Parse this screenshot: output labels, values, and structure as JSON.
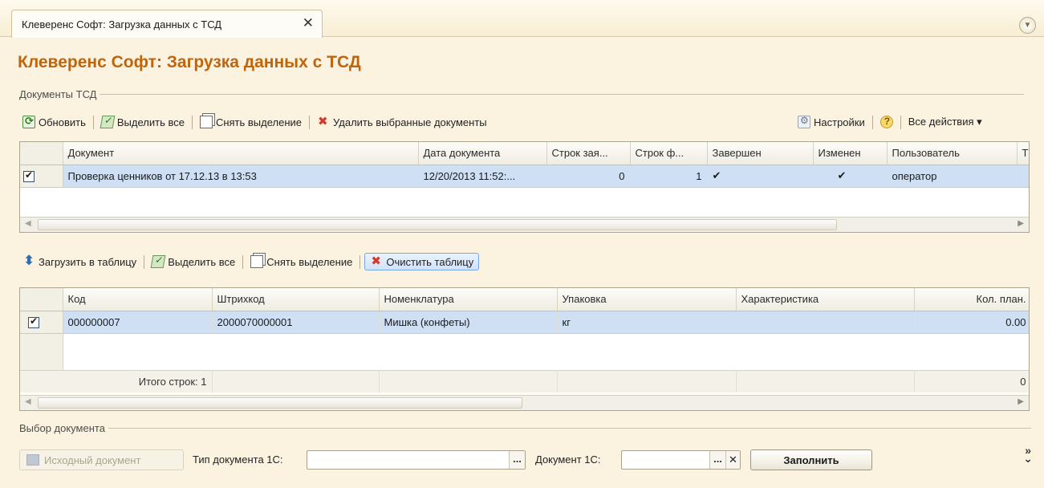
{
  "tab": {
    "title": "Клеверенс Софт: Загрузка данных с ТСД",
    "close_glyph": "✕"
  },
  "page_title": "Клеверенс Софт: Загрузка данных с ТСД",
  "docs_group": {
    "label": "Документы ТСД",
    "toolbar": {
      "refresh": "Обновить",
      "select_all": "Выделить все",
      "deselect": "Снять выделение",
      "delete_selected": "Удалить выбранные документы",
      "settings": "Настройки",
      "all_actions": "Все действия ▾"
    },
    "columns": [
      "Документ",
      "Дата документа",
      "Строк зая...",
      "Строк ф...",
      "Завершен",
      "Изменен",
      "Пользователь",
      "ТС"
    ],
    "rows": [
      {
        "checked": true,
        "document": "Проверка ценников от 17.12.13 в 13:53",
        "date": "12/20/2013 11:52:...",
        "lines_requested": "0",
        "lines_actual": "1",
        "completed": "✔",
        "changed": "✔",
        "user": "оператор",
        "tsd": ""
      }
    ]
  },
  "items_group": {
    "toolbar": {
      "load_to_table": "Загрузить в таблицу",
      "select_all": "Выделить все",
      "deselect": "Снять выделение",
      "clear_table": "Очистить таблицу"
    },
    "columns": [
      "Код",
      "Штрихкод",
      "Номенклатура",
      "Упаковка",
      "Характеристика",
      "Кол. план."
    ],
    "rows": [
      {
        "checked": true,
        "code": "000000007",
        "barcode": "2000070000001",
        "nomenclature": "Мишка (конфеты)",
        "package": "кг",
        "characteristic": "",
        "qty_plan": "0.00"
      }
    ],
    "footer": {
      "total_label": "Итого строк: 1",
      "qty_total": "0"
    }
  },
  "doc_select_group": {
    "label": "Выбор документа",
    "source_doc_button": "Исходный документ",
    "doc_type_label": "Тип документа 1С:",
    "doc_type_value": "",
    "doc_label": "Документ 1С:",
    "doc_value": "",
    "fill_button": "Заполнить"
  },
  "colors": {
    "title": "#c0650c",
    "selection": "#cfe0f5",
    "background": "#fbf3df"
  }
}
